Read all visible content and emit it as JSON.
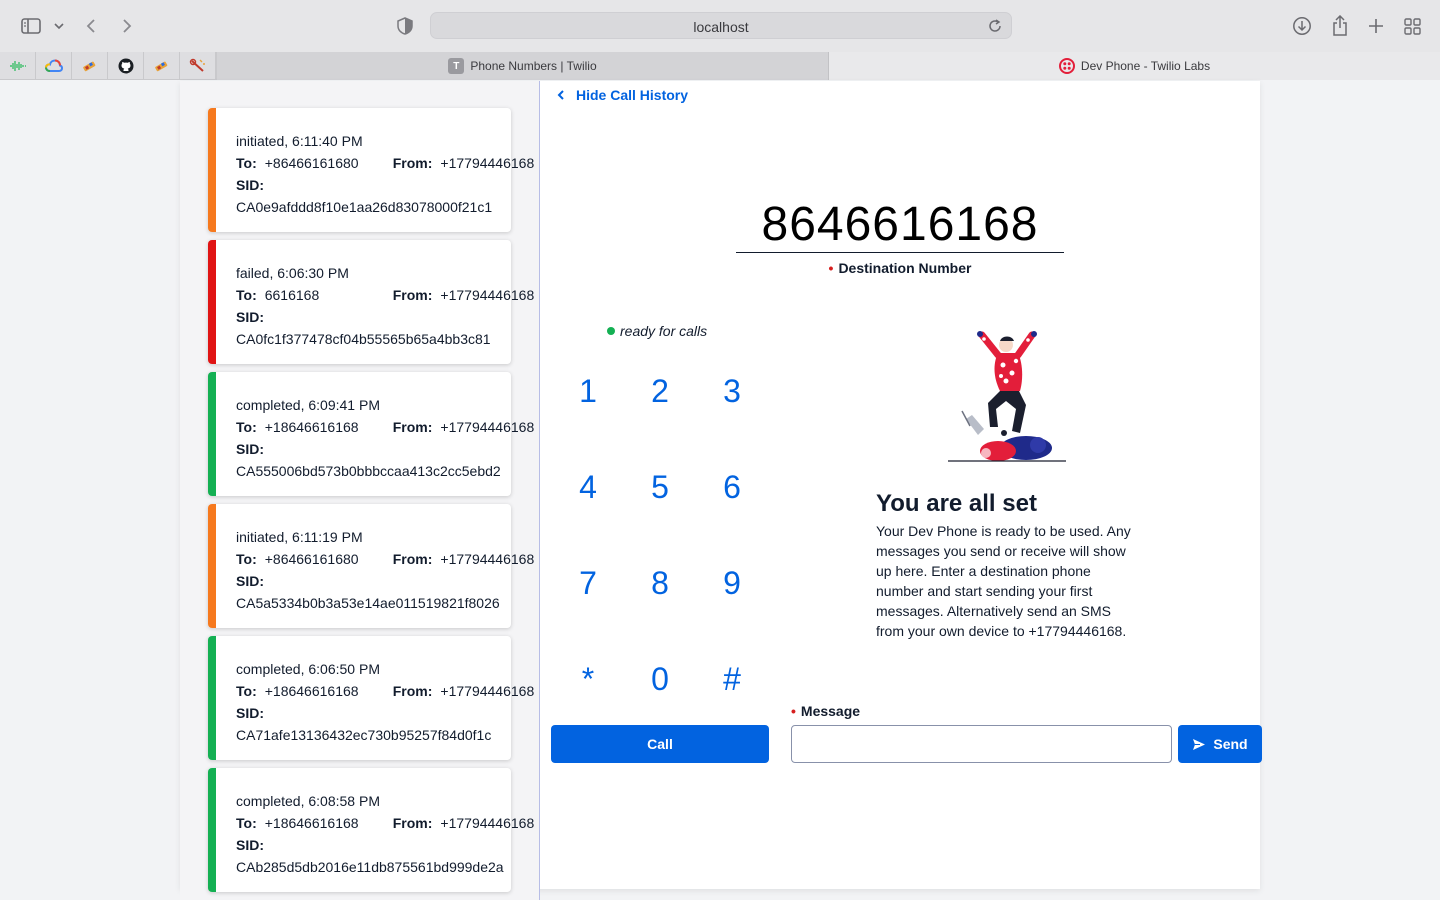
{
  "browser": {
    "url": "localhost",
    "tabs": [
      {
        "title": "Phone Numbers | Twilio",
        "icon_letter": "T"
      },
      {
        "title": "Dev Phone - Twilio Labs"
      }
    ]
  },
  "history": {
    "toggle_label": "Hide Call History",
    "calls": [
      {
        "status": "initiated",
        "time": "6:11:40 PM",
        "to": "+86466161680",
        "from": "+17794446168",
        "sid": "CA0e9afddd8f10e1aa26d83078000f21c1",
        "color": "#f6791e"
      },
      {
        "status": "failed",
        "time": "6:06:30 PM",
        "to": "6616168",
        "from": "+17794446168",
        "sid": "CA0fc1f377478cf04b55565b65a4bb3c81",
        "color": "#e01414"
      },
      {
        "status": "completed",
        "time": "6:09:41 PM",
        "to": "+18646616168",
        "from": "+17794446168",
        "sid": "CA555006bd573b0bbbccaa413c2cc5ebd2",
        "color": "#14b053"
      },
      {
        "status": "initiated",
        "time": "6:11:19 PM",
        "to": "+86466161680",
        "from": "+17794446168",
        "sid": "CA5a5334b0b3a53e14ae011519821f8026",
        "color": "#f6791e"
      },
      {
        "status": "completed",
        "time": "6:06:50 PM",
        "to": "+18646616168",
        "from": "+17794446168",
        "sid": "CA71afe13136432ec730b95257f84d0f1c",
        "color": "#14b053"
      },
      {
        "status": "completed",
        "time": "6:08:58 PM",
        "to": "+18646616168",
        "from": "+17794446168",
        "sid": "CAb285d5db2016e11db875561bd999de2a",
        "color": "#14b053"
      }
    ],
    "labels": {
      "to": "To:",
      "from": "From:",
      "sid": "SID:"
    }
  },
  "dialer": {
    "destination_number": "8646616168",
    "destination_label": "Destination Number",
    "status_text": "ready for calls",
    "keys": [
      "1",
      "2",
      "3",
      "4",
      "5",
      "6",
      "7",
      "8",
      "9",
      "*",
      "0",
      "#"
    ],
    "call_label": "Call"
  },
  "welcome": {
    "title": "You are all set",
    "body": "Your Dev Phone is ready to be used. Any messages you send or receive will show up here. Enter a destination phone number and start sending your first messages. Alternatively send an SMS from your own device to +17794446168."
  },
  "message": {
    "label": "Message",
    "value": "",
    "send_label": "Send"
  },
  "colors": {
    "accent": "#0263e0",
    "ready": "#14b053"
  }
}
